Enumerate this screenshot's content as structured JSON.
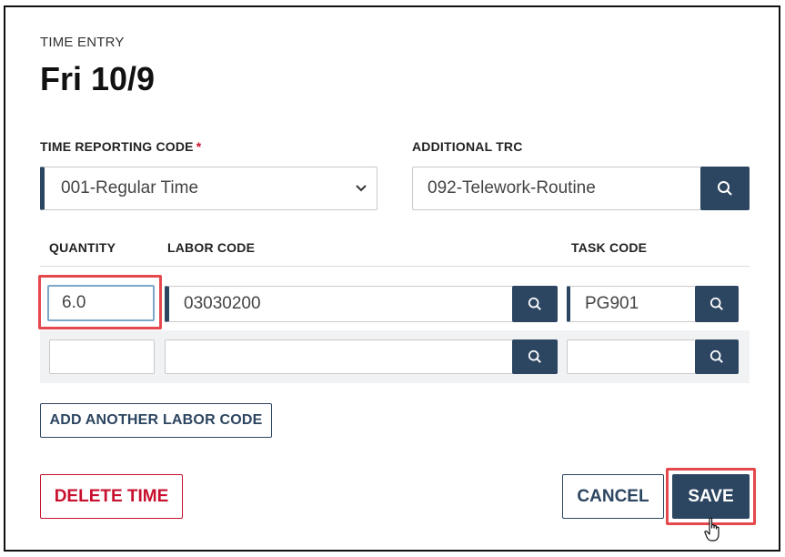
{
  "header": {
    "eyebrow": "TIME ENTRY",
    "title": "Fri 10/9"
  },
  "trc": {
    "label": "TIME REPORTING CODE",
    "required_mark": "*",
    "selected": "001-Regular Time"
  },
  "additional_trc": {
    "label": "ADDITIONAL TRC",
    "value": "092-Telework-Routine"
  },
  "table": {
    "headers": {
      "quantity": "QUANTITY",
      "labor_code": "LABOR CODE",
      "task_code": "TASK CODE"
    },
    "rows": [
      {
        "quantity": "6.0",
        "labor_code": "03030200",
        "task_code": "PG901"
      },
      {
        "quantity": "",
        "labor_code": "",
        "task_code": ""
      }
    ]
  },
  "actions": {
    "add_labor_code": "ADD ANOTHER LABOR CODE",
    "delete": "DELETE TIME",
    "cancel": "CANCEL",
    "save": "SAVE"
  },
  "colors": {
    "primary": "#2c4560",
    "danger": "#c8102e",
    "highlight": "#e5484d",
    "row_alt_bg": "#f1f2f4"
  },
  "icons": {
    "search": "search-icon",
    "dropdown": "chevron-down-icon",
    "cursor": "hand-pointer-icon"
  }
}
